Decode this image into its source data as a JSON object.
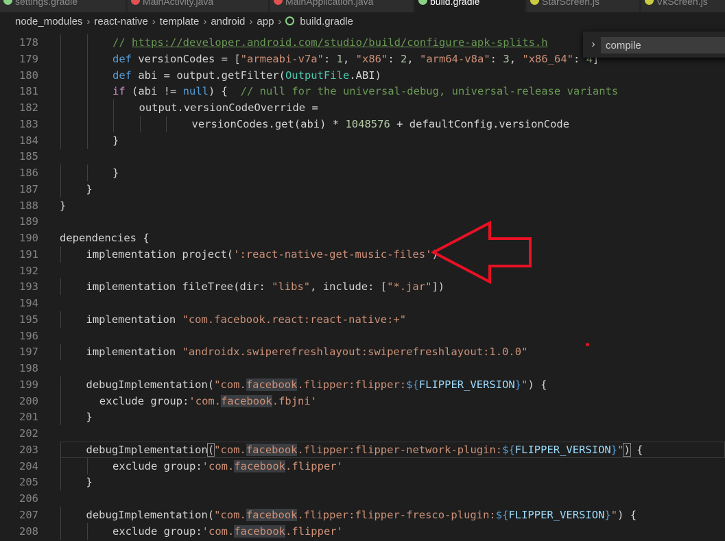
{
  "tabs": [
    {
      "label": "settings.gradle",
      "icon": "gradle-icon",
      "active": false
    },
    {
      "label": "MainActivity.java",
      "icon": "java-icon",
      "active": false
    },
    {
      "label": "MainApplication.java",
      "icon": "java-icon",
      "active": false
    },
    {
      "label": "build.gradle",
      "icon": "gradle-icon",
      "active": true
    },
    {
      "label": "StarScreen.js",
      "icon": "js-icon",
      "active": false
    },
    {
      "label": "VkScreen.js",
      "icon": "js-icon",
      "active": false
    }
  ],
  "breadcrumb": [
    "node_modules",
    "react-native",
    "template",
    "android",
    "app",
    "build.gradle"
  ],
  "find": {
    "value": "compile",
    "toggle": "›"
  },
  "colors": {
    "editor_bg": "#1e1e1e",
    "keyword": "#569cd6",
    "string": "#ce9178",
    "comment": "#6a9955",
    "annotation": "#e81123"
  },
  "code_lines": [
    {
      "n": "178",
      "indent": 2,
      "tokens": [
        [
          "cmt",
          "// "
        ],
        [
          "url",
          "https://developer.android.com/studio/build/configure-apk-splits.h"
        ]
      ]
    },
    {
      "n": "179",
      "indent": 2,
      "tokens": [
        [
          "kw",
          "def"
        ],
        [
          "pl",
          " versionCodes = ["
        ],
        [
          "str",
          "\"armeabi-v7a\""
        ],
        [
          "pl",
          ": "
        ],
        [
          "num",
          "1"
        ],
        [
          "pl",
          ", "
        ],
        [
          "str",
          "\"x86\""
        ],
        [
          "pl",
          ": "
        ],
        [
          "num",
          "2"
        ],
        [
          "pl",
          ", "
        ],
        [
          "str",
          "\"arm64-v8a\""
        ],
        [
          "pl",
          ": "
        ],
        [
          "num",
          "3"
        ],
        [
          "pl",
          ", "
        ],
        [
          "str",
          "\"x86_64\""
        ],
        [
          "pl",
          ": "
        ],
        [
          "num",
          "4"
        ],
        [
          "pl",
          "]"
        ]
      ]
    },
    {
      "n": "180",
      "indent": 2,
      "tokens": [
        [
          "kw",
          "def"
        ],
        [
          "pl",
          " abi = output.getFilter("
        ],
        [
          "type",
          "OutputFile"
        ],
        [
          "pl",
          ".ABI)"
        ]
      ]
    },
    {
      "n": "181",
      "indent": 2,
      "tokens": [
        [
          "ctrl",
          "if"
        ],
        [
          "pl",
          " (abi != "
        ],
        [
          "kw",
          "null"
        ],
        [
          "pl",
          ") {  "
        ],
        [
          "cmt",
          "// null for the universal-debug, universal-release variants"
        ]
      ]
    },
    {
      "n": "182",
      "indent": 3,
      "tokens": [
        [
          "pl",
          "output.versionCodeOverride ="
        ]
      ]
    },
    {
      "n": "183",
      "indent": 5,
      "tokens": [
        [
          "pl",
          "versionCodes.get(abi) * "
        ],
        [
          "num",
          "1048576"
        ],
        [
          "pl",
          " + defaultConfig.versionCode"
        ]
      ]
    },
    {
      "n": "184",
      "indent": 2,
      "tokens": [
        [
          "pl",
          "}"
        ]
      ]
    },
    {
      "n": "185",
      "indent": 0,
      "tokens": []
    },
    {
      "n": "186",
      "indent": 2,
      "tokens": [
        [
          "pl",
          "}"
        ]
      ]
    },
    {
      "n": "187",
      "indent": 1,
      "tokens": [
        [
          "pl",
          "}"
        ]
      ]
    },
    {
      "n": "188",
      "indent": 0,
      "tokens": [
        [
          "pl",
          "}"
        ]
      ]
    },
    {
      "n": "189",
      "indent": 0,
      "tokens": []
    },
    {
      "n": "190",
      "indent": 0,
      "tokens": [
        [
          "pl",
          "dependencies {"
        ]
      ]
    },
    {
      "n": "191",
      "indent": 1,
      "tokens": [
        [
          "pl",
          "implementation project("
        ],
        [
          "str",
          "':react-native-get-music-files'"
        ],
        [
          "pl",
          ")"
        ]
      ]
    },
    {
      "n": "192",
      "indent": 0,
      "tokens": []
    },
    {
      "n": "193",
      "indent": 1,
      "tokens": [
        [
          "pl",
          "implementation fileTree(dir: "
        ],
        [
          "str",
          "\"libs\""
        ],
        [
          "pl",
          ", include: ["
        ],
        [
          "str",
          "\"*.jar\""
        ],
        [
          "pl",
          "])"
        ]
      ]
    },
    {
      "n": "194",
      "indent": 0,
      "tokens": []
    },
    {
      "n": "195",
      "indent": 1,
      "tokens": [
        [
          "pl",
          "implementation "
        ],
        [
          "str",
          "\"com.facebook.react:react-native:+\""
        ]
      ]
    },
    {
      "n": "196",
      "indent": 0,
      "tokens": []
    },
    {
      "n": "197",
      "indent": 1,
      "tokens": [
        [
          "pl",
          "implementation "
        ],
        [
          "str",
          "\"androidx.swiperefreshlayout:swiperefreshlayout:1.0.0\""
        ]
      ]
    },
    {
      "n": "198",
      "indent": 0,
      "tokens": []
    },
    {
      "n": "199",
      "indent": 1,
      "tokens": [
        [
          "pl",
          "debugImplementation("
        ],
        [
          "str",
          "\"com."
        ],
        [
          "str hl",
          "facebook"
        ],
        [
          "str",
          ".flipper:flipper:"
        ],
        [
          "kw",
          "${"
        ],
        [
          "var",
          "FLIPPER_VERSION"
        ],
        [
          "kw",
          "}"
        ],
        [
          "str",
          "\""
        ],
        [
          "pl",
          ") {"
        ]
      ]
    },
    {
      "n": "200",
      "indent": 1.5,
      "tokens": [
        [
          "pl",
          "exclude group:"
        ],
        [
          "str",
          "'com."
        ],
        [
          "str hl",
          "facebook"
        ],
        [
          "str",
          ".fbjni'"
        ]
      ]
    },
    {
      "n": "201",
      "indent": 1,
      "tokens": [
        [
          "pl",
          "}"
        ]
      ]
    },
    {
      "n": "202",
      "indent": 0,
      "tokens": []
    },
    {
      "n": "203",
      "indent": 1,
      "current": true,
      "tokens": [
        [
          "pl",
          "debugImplementation"
        ],
        [
          "pl bm",
          "("
        ],
        [
          "str",
          "\"com."
        ],
        [
          "str hl",
          "facebook"
        ],
        [
          "str",
          ".flipper:flipper-network-plugin:"
        ],
        [
          "kw",
          "${"
        ],
        [
          "var",
          "FLIPPER_VERSION"
        ],
        [
          "kw",
          "}"
        ],
        [
          "str",
          "\""
        ],
        [
          "pl bm",
          ")"
        ],
        [
          "pl",
          " {"
        ]
      ]
    },
    {
      "n": "204",
      "indent": 2,
      "tokens": [
        [
          "pl",
          "exclude group:"
        ],
        [
          "str",
          "'com."
        ],
        [
          "str hl",
          "facebook"
        ],
        [
          "str",
          ".flipper'"
        ]
      ]
    },
    {
      "n": "205",
      "indent": 1,
      "tokens": [
        [
          "pl",
          "}"
        ]
      ]
    },
    {
      "n": "206",
      "indent": 0,
      "tokens": []
    },
    {
      "n": "207",
      "indent": 1,
      "tokens": [
        [
          "pl",
          "debugImplementation("
        ],
        [
          "str",
          "\"com."
        ],
        [
          "str hl",
          "facebook"
        ],
        [
          "str",
          ".flipper:flipper-fresco-plugin:"
        ],
        [
          "kw",
          "${"
        ],
        [
          "var",
          "FLIPPER_VERSION"
        ],
        [
          "kw",
          "}"
        ],
        [
          "str",
          "\""
        ],
        [
          "pl",
          ") {"
        ]
      ]
    },
    {
      "n": "208",
      "indent": 2,
      "tokens": [
        [
          "pl",
          "exclude group:"
        ],
        [
          "str",
          "'com."
        ],
        [
          "str hl",
          "facebook"
        ],
        [
          "str",
          ".flipper'"
        ]
      ]
    }
  ]
}
